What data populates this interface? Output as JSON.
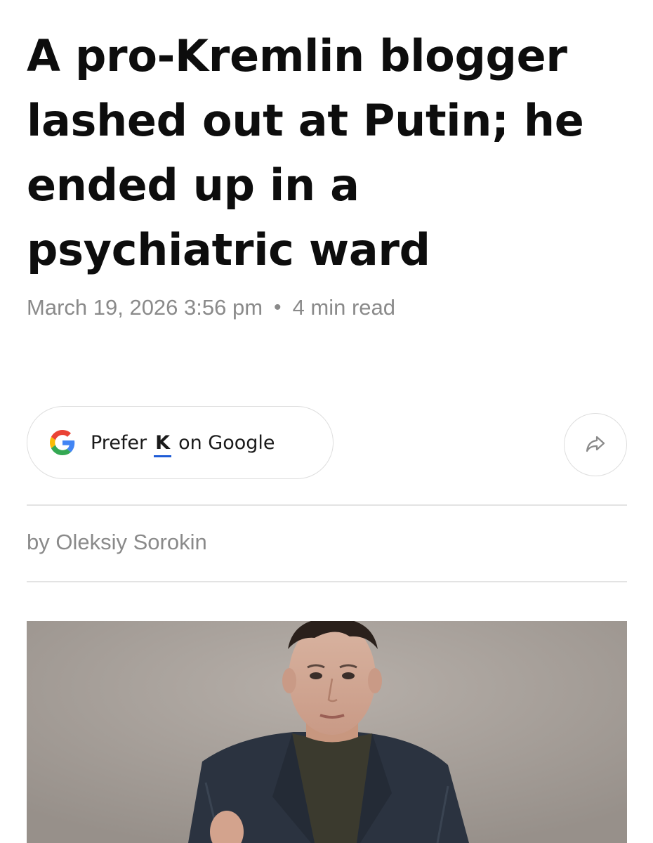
{
  "article": {
    "headline": "A pro-Kremlin blogger lashed out at Putin; he ended up in a psychiatric ward",
    "date": "March 19, 2026 3:56 pm",
    "separator": "•",
    "read_time": "4 min read",
    "byline_prefix": "by",
    "author": "Oleksiy Sorokin"
  },
  "prefer_button": {
    "text_before": "Prefer",
    "brand_mark": "K",
    "text_after": "on Google",
    "icon": "google-g-icon"
  },
  "share_button": {
    "icon": "share-arrow-icon"
  },
  "colors": {
    "headline": "#0d0d0d",
    "meta_text": "#8a8a8a",
    "divider": "#e3e3e3",
    "brand_underline": "#1e5bd6",
    "google_blue": "#4285F4",
    "google_red": "#EA4335",
    "google_yellow": "#FBBC05",
    "google_green": "#34A853",
    "photo_background": "#a59e98"
  }
}
